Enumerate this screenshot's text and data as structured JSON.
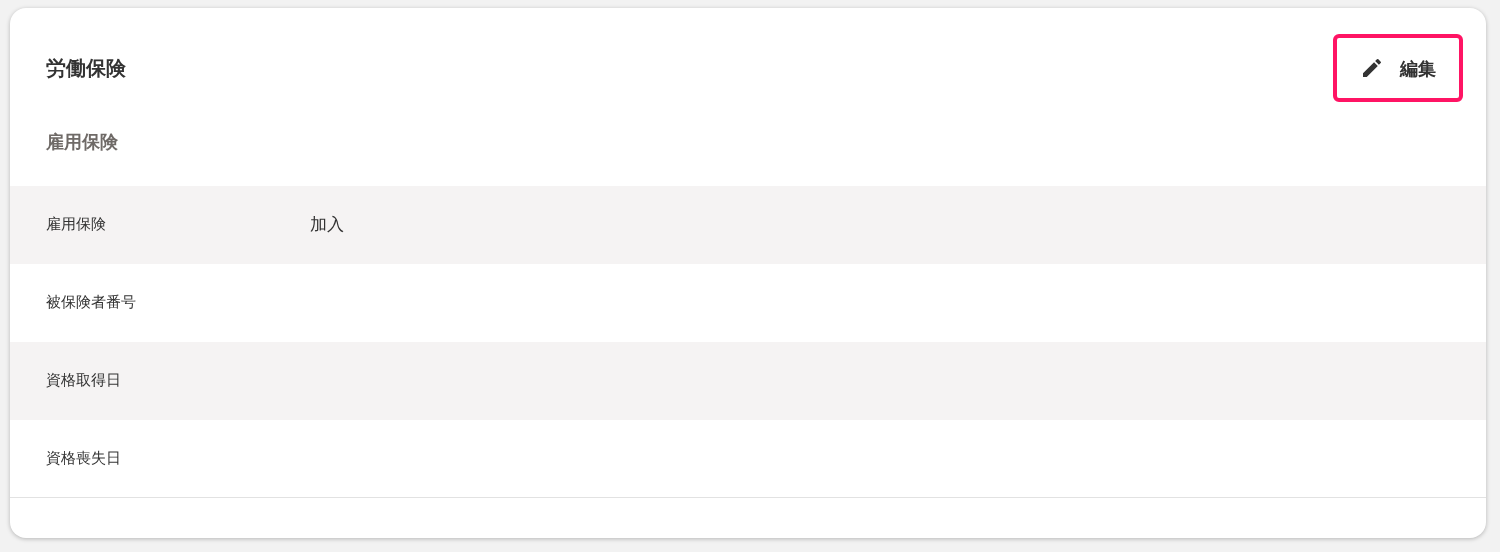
{
  "card": {
    "title": "労働保険",
    "edit_button": {
      "label": "編集",
      "highlighted": true
    }
  },
  "section": {
    "heading": "雇用保険",
    "rows": [
      {
        "label": "雇用保険",
        "value": "加入"
      },
      {
        "label": "被保険者番号"
      },
      {
        "label": "資格取得日"
      },
      {
        "label": "資格喪失日"
      }
    ]
  }
}
